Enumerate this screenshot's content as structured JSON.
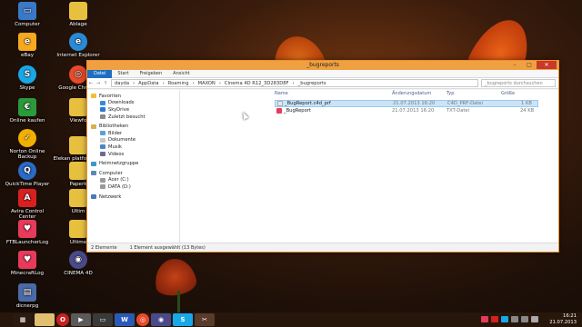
{
  "desktop_icons": [
    {
      "label": "Computer",
      "color": "#3a78c8"
    },
    {
      "label": "Ablage",
      "color": "#e8c040"
    },
    {
      "label": "eBay",
      "color": "#f5a820"
    },
    {
      "label": "Internet Explorer",
      "color": "#2a8ad8"
    },
    {
      "label": "Skype",
      "color": "#18a8e8"
    },
    {
      "label": "Google Chrome",
      "color": "#e84a2a"
    },
    {
      "label": "Online kaufen",
      "color": "#2a9a3a"
    },
    {
      "label": "Viewfo",
      "color": "#e8c040"
    },
    {
      "label": "Norton Online Backup",
      "color": "#f0b000"
    },
    {
      "label": "Elekan platfo sacha",
      "color": "#e8c040"
    },
    {
      "label": "QuickTime Player",
      "color": "#2a6ac8"
    },
    {
      "label": "Paperk",
      "color": "#e8c040"
    },
    {
      "label": "Avira Control Center",
      "color": "#d82020"
    },
    {
      "label": "Ultim",
      "color": "#e8c040"
    },
    {
      "label": "FTBLauncherLog",
      "color": "#e83a5a"
    },
    {
      "label": "Ultime",
      "color": "#e8c040"
    },
    {
      "label": "MinecraftLog",
      "color": "#e83a5a"
    },
    {
      "label": "CINEMA 4D",
      "color": "#4a4a8a"
    },
    {
      "label": "dicnerpg",
      "color": "#4a6aa8"
    }
  ],
  "window": {
    "title": "_bugreports",
    "controls": {
      "minimize": "–",
      "maximize": "□",
      "close": "✕"
    },
    "ribbon_tabs": [
      "Datei",
      "Start",
      "Freigeben",
      "Ansicht"
    ],
    "address": {
      "back": "←",
      "forward": "→",
      "up": "↑",
      "path": [
        "dayda",
        "AppData",
        "Roaming",
        "MAXON",
        "Cinema 4D R12_3D283D8F",
        "_bugreports"
      ],
      "search_placeholder": "_bugreports durchsuchen"
    },
    "nav": {
      "favorites_header": "Favoriten",
      "favorites": [
        "Downloads",
        "SkyDrive",
        "Zuletzt besucht"
      ],
      "libraries_header": "Bibliotheken",
      "libraries": [
        "Bilder",
        "Dokumente",
        "Musik",
        "Videos"
      ],
      "homegroup": "Heimnetzgruppe",
      "computer_header": "Computer",
      "drives": [
        "Acer (C:)",
        "DATA (D:)"
      ],
      "network": "Netzwerk"
    },
    "columns": {
      "name": "Name",
      "date": "Änderungsdatum",
      "type": "Typ",
      "size": "Größe"
    },
    "files": [
      {
        "name": "_BugReport.c4d_prf",
        "date": "21.07.2013 16:20",
        "type": "C4D_PRF-Datei",
        "size": "1 KB",
        "selected": true
      },
      {
        "name": "_BugReport",
        "date": "21.07.2013 16:20",
        "type": "TXT-Datei",
        "size": "24 KB",
        "selected": false
      }
    ],
    "status": {
      "count": "2 Elemente",
      "selection": "1 Element ausgewählt (13 Bytes)"
    }
  },
  "taskbar": {
    "apps": [
      "start-icon",
      "explorer-icon",
      "opera-icon",
      "media-icon",
      "terminal-icon",
      "word-icon",
      "chrome-icon",
      "c4d-icon",
      "skype-icon",
      "media2-icon"
    ],
    "time": "16:21",
    "date": "21.07.2013"
  }
}
